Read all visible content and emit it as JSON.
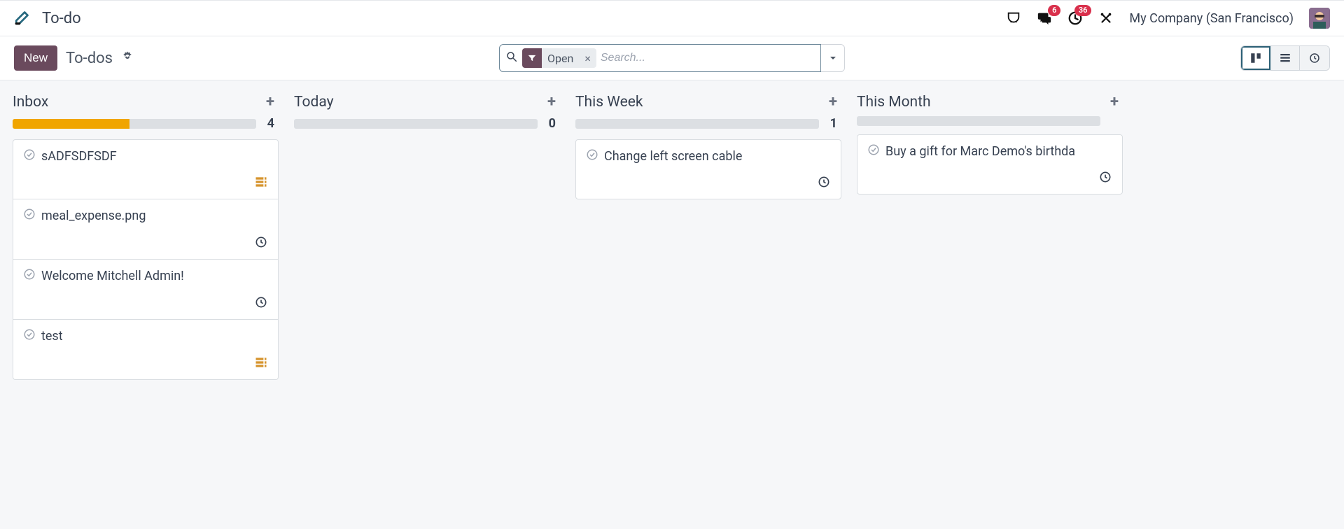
{
  "header": {
    "app_title": "To-do",
    "company": "My Company (San Francisco)",
    "badges": {
      "messages": "6",
      "activities": "36"
    }
  },
  "controlbar": {
    "new_label": "New",
    "breadcrumb": "To-dos",
    "search": {
      "placeholder": "Search...",
      "filter_label": "Open"
    }
  },
  "columns": [
    {
      "title": "Inbox",
      "count": "4",
      "progress_pct": 48,
      "cards": [
        {
          "title": "sADFSDFSDF",
          "footer_icon": "stack"
        },
        {
          "title": "meal_expense.png",
          "footer_icon": "clock"
        },
        {
          "title": "Welcome Mitchell Admin!",
          "footer_icon": "clock"
        },
        {
          "title": "test",
          "footer_icon": "stack"
        }
      ]
    },
    {
      "title": "Today",
      "count": "0",
      "progress_pct": 0,
      "cards": []
    },
    {
      "title": "This Week",
      "count": "1",
      "progress_pct": 0,
      "cards": [
        {
          "title": "Change left screen cable",
          "footer_icon": "clock"
        }
      ]
    },
    {
      "title": "This Month",
      "count": "",
      "progress_pct": 0,
      "cards": [
        {
          "title": "Buy a gift for Marc Demo's birthda",
          "footer_icon": "clock"
        }
      ]
    }
  ]
}
